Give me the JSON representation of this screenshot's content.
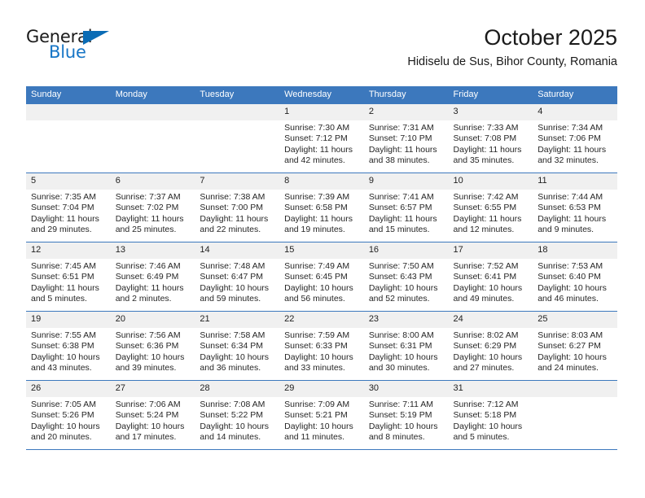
{
  "brand": {
    "word_one": "General",
    "word_two": "Blue",
    "triangle_icon": "blue-triangle-icon"
  },
  "header": {
    "title": "October 2025",
    "subtitle": "Hidiselu de Sus, Bihor County, Romania"
  },
  "theme": {
    "header_blue": "#3c78bd",
    "daystrip_gray": "#f0f0f0",
    "brand_blue": "#1675c6",
    "text": "#262626"
  },
  "weekday_headers": [
    "Sunday",
    "Monday",
    "Tuesday",
    "Wednesday",
    "Thursday",
    "Friday",
    "Saturday"
  ],
  "weeks": [
    [
      {
        "day": "",
        "lines": []
      },
      {
        "day": "",
        "lines": []
      },
      {
        "day": "",
        "lines": []
      },
      {
        "day": "1",
        "lines": [
          "Sunrise: 7:30 AM",
          "Sunset: 7:12 PM",
          "Daylight: 11 hours",
          "and 42 minutes."
        ]
      },
      {
        "day": "2",
        "lines": [
          "Sunrise: 7:31 AM",
          "Sunset: 7:10 PM",
          "Daylight: 11 hours",
          "and 38 minutes."
        ]
      },
      {
        "day": "3",
        "lines": [
          "Sunrise: 7:33 AM",
          "Sunset: 7:08 PM",
          "Daylight: 11 hours",
          "and 35 minutes."
        ]
      },
      {
        "day": "4",
        "lines": [
          "Sunrise: 7:34 AM",
          "Sunset: 7:06 PM",
          "Daylight: 11 hours",
          "and 32 minutes."
        ]
      }
    ],
    [
      {
        "day": "5",
        "lines": [
          "Sunrise: 7:35 AM",
          "Sunset: 7:04 PM",
          "Daylight: 11 hours",
          "and 29 minutes."
        ]
      },
      {
        "day": "6",
        "lines": [
          "Sunrise: 7:37 AM",
          "Sunset: 7:02 PM",
          "Daylight: 11 hours",
          "and 25 minutes."
        ]
      },
      {
        "day": "7",
        "lines": [
          "Sunrise: 7:38 AM",
          "Sunset: 7:00 PM",
          "Daylight: 11 hours",
          "and 22 minutes."
        ]
      },
      {
        "day": "8",
        "lines": [
          "Sunrise: 7:39 AM",
          "Sunset: 6:58 PM",
          "Daylight: 11 hours",
          "and 19 minutes."
        ]
      },
      {
        "day": "9",
        "lines": [
          "Sunrise: 7:41 AM",
          "Sunset: 6:57 PM",
          "Daylight: 11 hours",
          "and 15 minutes."
        ]
      },
      {
        "day": "10",
        "lines": [
          "Sunrise: 7:42 AM",
          "Sunset: 6:55 PM",
          "Daylight: 11 hours",
          "and 12 minutes."
        ]
      },
      {
        "day": "11",
        "lines": [
          "Sunrise: 7:44 AM",
          "Sunset: 6:53 PM",
          "Daylight: 11 hours",
          "and 9 minutes."
        ]
      }
    ],
    [
      {
        "day": "12",
        "lines": [
          "Sunrise: 7:45 AM",
          "Sunset: 6:51 PM",
          "Daylight: 11 hours",
          "and 5 minutes."
        ]
      },
      {
        "day": "13",
        "lines": [
          "Sunrise: 7:46 AM",
          "Sunset: 6:49 PM",
          "Daylight: 11 hours",
          "and 2 minutes."
        ]
      },
      {
        "day": "14",
        "lines": [
          "Sunrise: 7:48 AM",
          "Sunset: 6:47 PM",
          "Daylight: 10 hours",
          "and 59 minutes."
        ]
      },
      {
        "day": "15",
        "lines": [
          "Sunrise: 7:49 AM",
          "Sunset: 6:45 PM",
          "Daylight: 10 hours",
          "and 56 minutes."
        ]
      },
      {
        "day": "16",
        "lines": [
          "Sunrise: 7:50 AM",
          "Sunset: 6:43 PM",
          "Daylight: 10 hours",
          "and 52 minutes."
        ]
      },
      {
        "day": "17",
        "lines": [
          "Sunrise: 7:52 AM",
          "Sunset: 6:41 PM",
          "Daylight: 10 hours",
          "and 49 minutes."
        ]
      },
      {
        "day": "18",
        "lines": [
          "Sunrise: 7:53 AM",
          "Sunset: 6:40 PM",
          "Daylight: 10 hours",
          "and 46 minutes."
        ]
      }
    ],
    [
      {
        "day": "19",
        "lines": [
          "Sunrise: 7:55 AM",
          "Sunset: 6:38 PM",
          "Daylight: 10 hours",
          "and 43 minutes."
        ]
      },
      {
        "day": "20",
        "lines": [
          "Sunrise: 7:56 AM",
          "Sunset: 6:36 PM",
          "Daylight: 10 hours",
          "and 39 minutes."
        ]
      },
      {
        "day": "21",
        "lines": [
          "Sunrise: 7:58 AM",
          "Sunset: 6:34 PM",
          "Daylight: 10 hours",
          "and 36 minutes."
        ]
      },
      {
        "day": "22",
        "lines": [
          "Sunrise: 7:59 AM",
          "Sunset: 6:33 PM",
          "Daylight: 10 hours",
          "and 33 minutes."
        ]
      },
      {
        "day": "23",
        "lines": [
          "Sunrise: 8:00 AM",
          "Sunset: 6:31 PM",
          "Daylight: 10 hours",
          "and 30 minutes."
        ]
      },
      {
        "day": "24",
        "lines": [
          "Sunrise: 8:02 AM",
          "Sunset: 6:29 PM",
          "Daylight: 10 hours",
          "and 27 minutes."
        ]
      },
      {
        "day": "25",
        "lines": [
          "Sunrise: 8:03 AM",
          "Sunset: 6:27 PM",
          "Daylight: 10 hours",
          "and 24 minutes."
        ]
      }
    ],
    [
      {
        "day": "26",
        "lines": [
          "Sunrise: 7:05 AM",
          "Sunset: 5:26 PM",
          "Daylight: 10 hours",
          "and 20 minutes."
        ]
      },
      {
        "day": "27",
        "lines": [
          "Sunrise: 7:06 AM",
          "Sunset: 5:24 PM",
          "Daylight: 10 hours",
          "and 17 minutes."
        ]
      },
      {
        "day": "28",
        "lines": [
          "Sunrise: 7:08 AM",
          "Sunset: 5:22 PM",
          "Daylight: 10 hours",
          "and 14 minutes."
        ]
      },
      {
        "day": "29",
        "lines": [
          "Sunrise: 7:09 AM",
          "Sunset: 5:21 PM",
          "Daylight: 10 hours",
          "and 11 minutes."
        ]
      },
      {
        "day": "30",
        "lines": [
          "Sunrise: 7:11 AM",
          "Sunset: 5:19 PM",
          "Daylight: 10 hours",
          "and 8 minutes."
        ]
      },
      {
        "day": "31",
        "lines": [
          "Sunrise: 7:12 AM",
          "Sunset: 5:18 PM",
          "Daylight: 10 hours",
          "and 5 minutes."
        ]
      },
      {
        "day": "",
        "lines": []
      }
    ]
  ]
}
